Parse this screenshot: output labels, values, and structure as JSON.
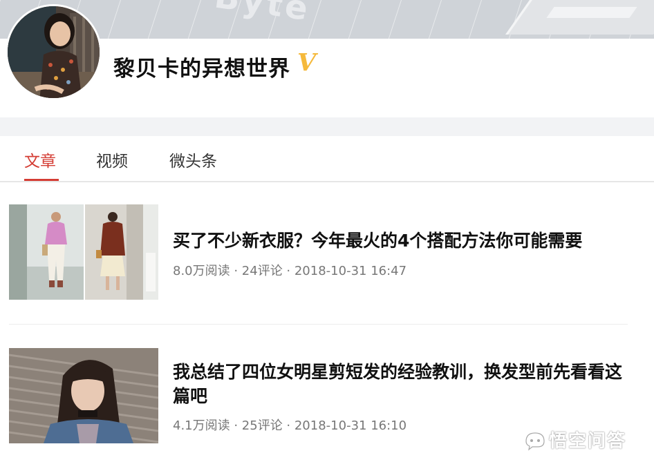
{
  "banner": {
    "decor_text": "Byte"
  },
  "profile": {
    "name": "黎贝卡的异想世界",
    "verified_mark": "V"
  },
  "tabs": [
    {
      "label": "文章",
      "active": true
    },
    {
      "label": "视频",
      "active": false
    },
    {
      "label": "微头条",
      "active": false
    }
  ],
  "articles": [
    {
      "title": "买了不少新衣服？今年最火的4个搭配方法你可能需要",
      "meta": "8.0万阅读 · 24评论 · 2018-10-31 16:47"
    },
    {
      "title": "我总结了四位女明星剪短发的经验教训，换发型前先看看这篇吧",
      "meta": "4.1万阅读 · 25评论 · 2018-10-31 16:10"
    }
  ],
  "watermark": {
    "text": "悟空问答",
    "icon": "wukong-logo-icon"
  },
  "colors": {
    "accent": "#d43c33",
    "verified": "#f5b93b",
    "meta": "#777777"
  }
}
